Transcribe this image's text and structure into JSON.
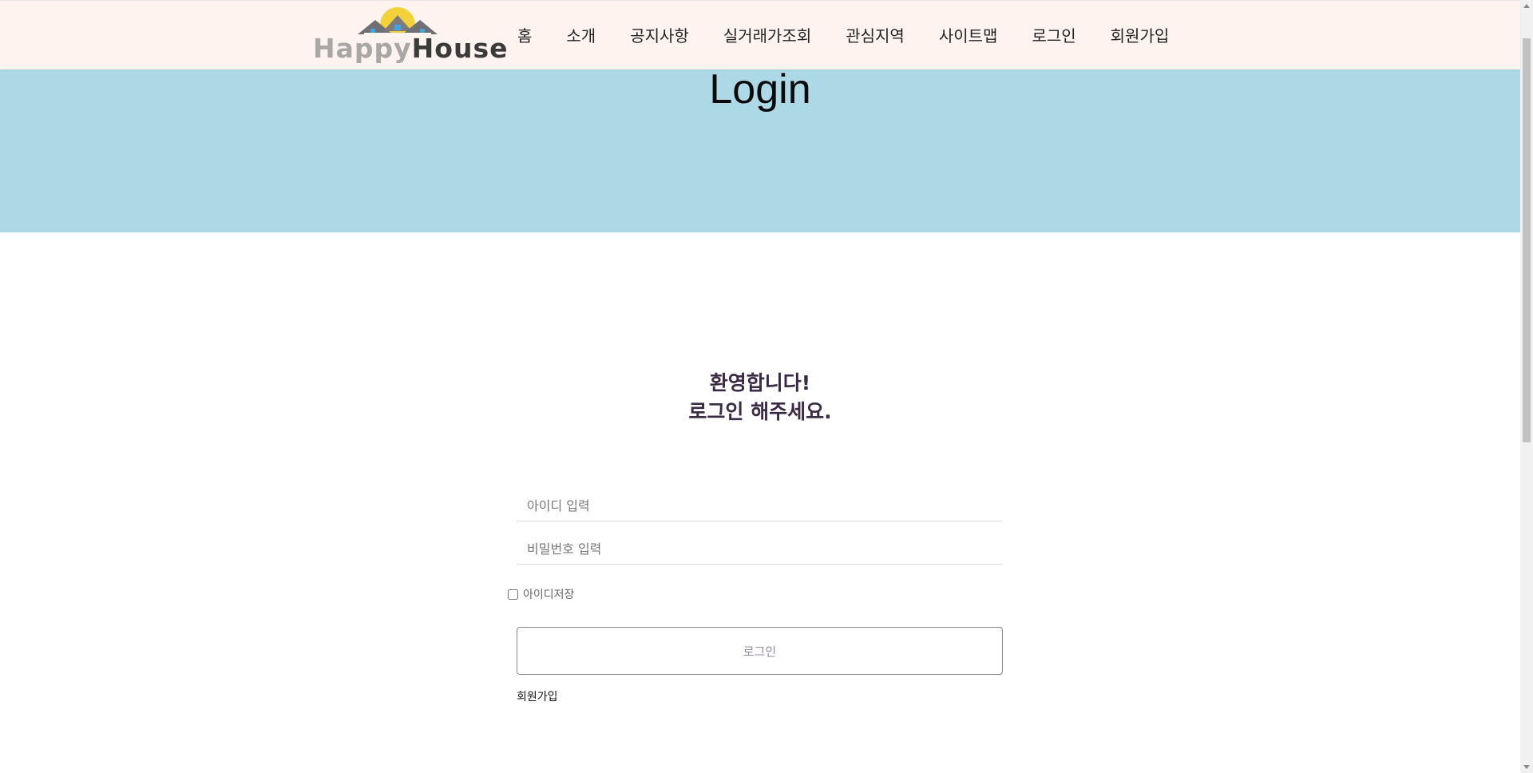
{
  "header": {
    "logo": {
      "part1": "Happy",
      "part2": "House",
      "icon": "house-with-sun-icon"
    },
    "nav": [
      "홈",
      "소개",
      "공지사항",
      "실거래가조회",
      "관심지역",
      "사이트맵",
      "로그인",
      "회원가입"
    ]
  },
  "hero": {
    "title": "Login"
  },
  "login": {
    "welcome_line1": "환영합니다!",
    "welcome_line2": "로그인 해주세요.",
    "id_placeholder": "아이디 입력",
    "pw_placeholder": "비밀번호 입력",
    "remember_label": "아이디저장",
    "remember_checked": false,
    "login_button": "로그인",
    "signup_link": "회원가입"
  },
  "colors": {
    "header_bg": "#fff3ef",
    "hero_bg": "#add8e6",
    "welcome_text": "#3a2a45",
    "logo_sun": "#f3d13a",
    "logo_roof": "#6f7074"
  }
}
